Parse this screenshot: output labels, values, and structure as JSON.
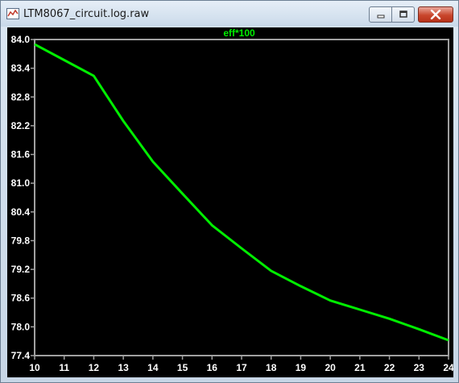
{
  "window": {
    "title": "LTM8067_circuit.log.raw",
    "buttons": {
      "minimize_icon": "minimize-icon",
      "maximize_icon": "maximize-icon",
      "close_icon": "close-icon"
    }
  },
  "colors": {
    "plot_bg": "#000000",
    "trace": "#00ee00",
    "axis_text": "#ffffff",
    "frame": "#a0a0a0"
  },
  "chart_data": {
    "type": "line",
    "title": "eff*100",
    "x": [
      10,
      11,
      12,
      13,
      14,
      15,
      16,
      17,
      18,
      19,
      20,
      21,
      22,
      23,
      24
    ],
    "series": [
      {
        "name": "eff*100",
        "values": [
          83.9,
          83.57,
          83.24,
          82.3,
          81.45,
          80.78,
          80.12,
          79.64,
          79.17,
          78.85,
          78.55,
          78.36,
          78.17,
          77.95,
          77.72
        ]
      }
    ],
    "xlim": [
      10,
      24
    ],
    "ylim": [
      77.4,
      84.0
    ],
    "x_ticks": [
      "10",
      "11",
      "12",
      "13",
      "14",
      "15",
      "16",
      "17",
      "18",
      "19",
      "20",
      "21",
      "22",
      "23",
      "24"
    ],
    "y_ticks": [
      "84.0",
      "83.4",
      "82.8",
      "82.2",
      "81.6",
      "81.0",
      "80.4",
      "79.8",
      "79.2",
      "78.6",
      "78.0",
      "77.4"
    ],
    "grid": false,
    "legend": "none"
  }
}
